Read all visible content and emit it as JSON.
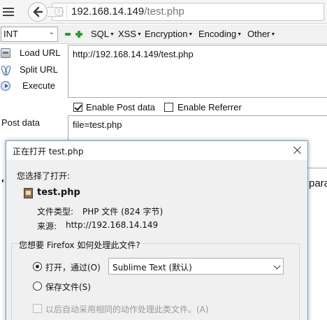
{
  "browser": {
    "url_host": "192.168.14.149",
    "url_path": "/test.php"
  },
  "hackbar": {
    "encoding_select": "INT",
    "menus": [
      "SQL",
      "XSS",
      "Encryption",
      "Encoding",
      "Other"
    ],
    "buttons": {
      "load_url": "Load URL",
      "split_url": "Split URL",
      "execute": "Execute"
    },
    "url_value": "http://192.168.14.149/test.php",
    "enable_post": "Enable Post data",
    "enable_post_checked": true,
    "enable_referrer": "Enable Referrer",
    "enable_referrer_checked": false,
    "post_label": "Post data",
    "post_value": "file=test.php"
  },
  "background_page": {
    "left_fragment": "'",
    "right_fragment": "para"
  },
  "dialog": {
    "title": "正在打开 test.php",
    "chose_to_open": "您选择了打开:",
    "file_name": "test.php",
    "file_type_label": "文件类型:",
    "file_type_value": "PHP 文件 (824 字节)",
    "source_label": "来源:",
    "source_value": "http://192.168.14.149",
    "question": "您想要 Firefox 如何处理此文件?",
    "open_with_label": "打开，通过(O)",
    "open_with_app": "Sublime Text (默认)",
    "save_file_label": "保存文件(S)",
    "selected_option": "open_with",
    "auto_label": "以后自动采用相同的动作处理此类文件。(A)"
  },
  "icons": {
    "menu": "hamburger-icon",
    "back": "back-arrow-icon",
    "info": "info-icon",
    "load": "load-url-icon",
    "split": "split-url-icon",
    "execute": "execute-icon",
    "file": "php-file-icon",
    "close": "close-icon"
  },
  "colors": {
    "hackbar_plus_minus": "#2e9c2e",
    "dialog_border": "#7a9ec8"
  }
}
